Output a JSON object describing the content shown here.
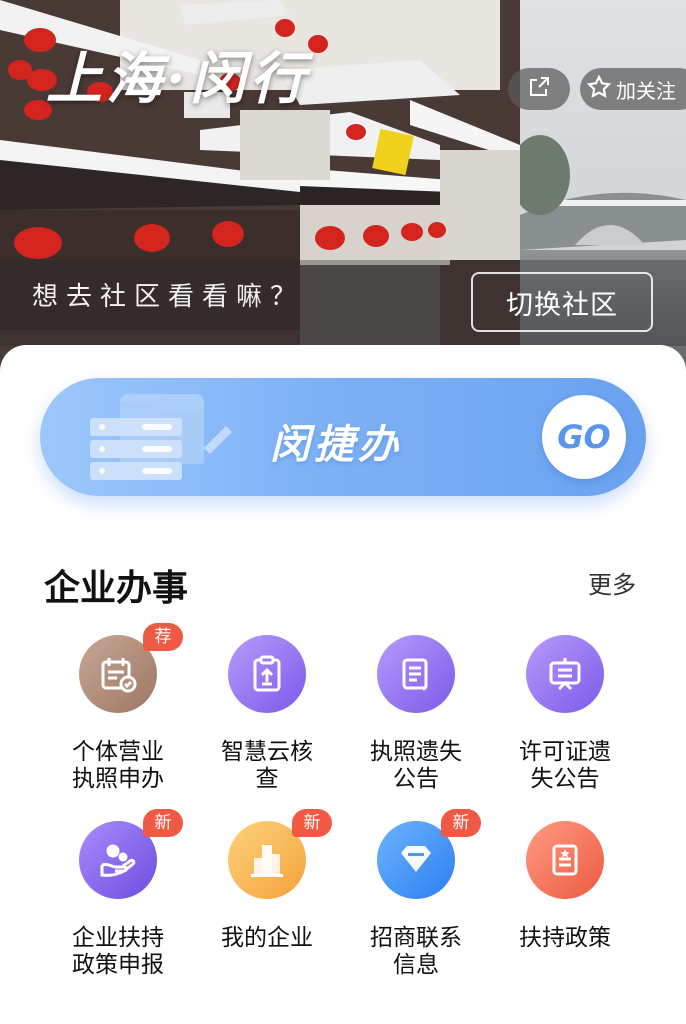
{
  "hero": {
    "title": "上海·闵行",
    "follow_label": "加关注",
    "prompt": "想去社区看看嘛？",
    "switch_label": "切换社区"
  },
  "banner": {
    "title": "闵捷办",
    "go_label": "GO"
  },
  "section": {
    "title": "企业办事",
    "more_label": "更多"
  },
  "services": [
    {
      "label_line1": "个体营业",
      "label_line2": "执照申办",
      "badge": "荐",
      "icon": "calendar-check-icon",
      "color": "#a98470"
    },
    {
      "label_line1": "智慧云核",
      "label_line2": "查",
      "badge": "",
      "icon": "clipboard-upload-icon",
      "color": "#8f6df0"
    },
    {
      "label_line1": "执照遗失",
      "label_line2": "公告",
      "badge": "",
      "icon": "document-lines-icon",
      "color": "#8f6df0"
    },
    {
      "label_line1": "许可证遗",
      "label_line2": "失公告",
      "badge": "",
      "icon": "easel-board-icon",
      "color": "#8f6df0"
    },
    {
      "label_line1": "企业扶持",
      "label_line2": "政策申报",
      "badge": "新",
      "icon": "hand-support-icon",
      "color": "#7c5fe8"
    },
    {
      "label_line1": "我的企业",
      "label_line2": "",
      "badge": "新",
      "icon": "buildings-icon",
      "color": "#f6b44c"
    },
    {
      "label_line1": "招商联系",
      "label_line2": "信息",
      "badge": "新",
      "icon": "diamond-icon",
      "color": "#3d8ef0"
    },
    {
      "label_line1": "扶持政策",
      "label_line2": "",
      "badge": "",
      "icon": "policy-document-icon",
      "color": "#f06a52"
    }
  ]
}
